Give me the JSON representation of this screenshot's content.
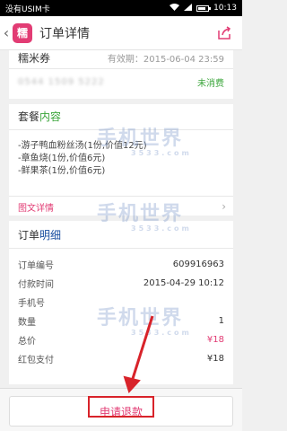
{
  "status_bar": {
    "carrier": "没有USIM卡",
    "time": "10:13",
    "battery_level": 0.8
  },
  "header": {
    "logo_text": "糯",
    "title": "订单详情",
    "back_icon": "chevron-left-icon",
    "share_icon": "share-icon"
  },
  "merchant": {
    "name": "糯米券",
    "validity": "有效期：2015-06-04  23:59",
    "phone": "0544 1509 5222",
    "status": "未消费"
  },
  "package": {
    "title_main": "套餐",
    "title_accent": "内容",
    "items": [
      "-游子鸭血粉丝汤(1份,价值12元)",
      "-章鱼烧(1份,价值6元)",
      "-鲜果茶(1份,价值6元)"
    ],
    "detail_link": "图文详情"
  },
  "order": {
    "title_main": "订单",
    "title_accent": "明细",
    "rows": [
      {
        "label": "订单编号",
        "value": "609916963"
      },
      {
        "label": "付款时间",
        "value": "2015-04-29 10:12"
      },
      {
        "label": "手机号",
        "value": ""
      },
      {
        "label": "数量",
        "value": "1"
      },
      {
        "label": "总价",
        "value": "¥18"
      },
      {
        "label": "红包支付",
        "value": "¥18"
      }
    ]
  },
  "refund_button": "申请退款",
  "watermark": {
    "text": "手机世界",
    "sub": "3533.com"
  },
  "colors": {
    "accent": "#e23c74",
    "green": "#3aa53a",
    "arrow": "#d8232a"
  }
}
